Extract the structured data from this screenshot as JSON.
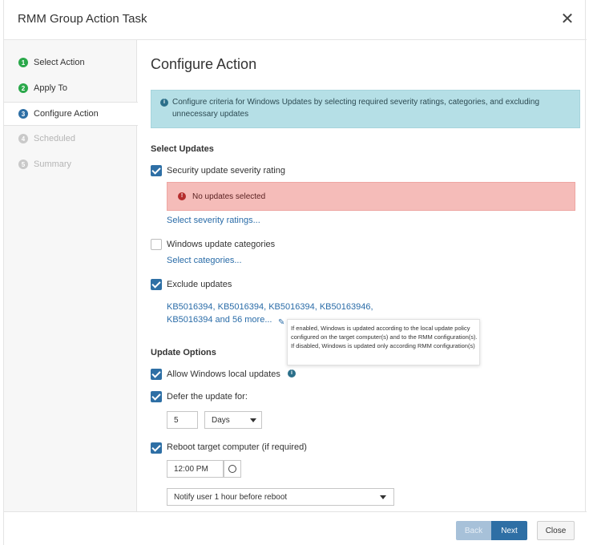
{
  "window": {
    "title": "RMM Group Action Task",
    "close_icon": "close-icon"
  },
  "steps": [
    {
      "num": "1",
      "label": "Select Action",
      "status": "done"
    },
    {
      "num": "2",
      "label": "Apply To",
      "status": "done"
    },
    {
      "num": "3",
      "label": "Configure Action",
      "status": "current"
    },
    {
      "num": "4",
      "label": "Scheduled",
      "status": "pending"
    },
    {
      "num": "5",
      "label": "Summary",
      "status": "pending"
    }
  ],
  "main": {
    "title": "Configure Action",
    "info_text": "Configure criteria for Windows Updates by selecting required severity ratings, categories, and excluding unnecessary updates",
    "select_updates_heading": "Select Updates",
    "severity": {
      "label": "Security update severity rating",
      "checked": true
    },
    "error_text": "No updates selected",
    "severity_link": "Select severity ratings...",
    "categories": {
      "label": "Windows update categories",
      "checked": false
    },
    "categories_link": "Select categories...",
    "exclude": {
      "label": "Exclude updates",
      "checked": true
    },
    "excluded_line1": "KB5016394, KB5016394, KB5016394, KB50163946,",
    "excluded_line2": "KB5016394 and 56 more...",
    "tooltip": "If enabled, Windows is updated according to the local update policy configured on the target computer(s) and to the RMM configuration(s). If disabled, Windows is updated only according RMM configuration(s)",
    "update_options_heading": "Update Options",
    "allow_local": {
      "label": "Allow Windows local updates",
      "checked": true
    },
    "defer": {
      "label": "Defer the update for:",
      "checked": true,
      "value": "5",
      "unit": "Days"
    },
    "reboot": {
      "label": "Reboot target computer (if required)",
      "checked": true,
      "time": "12:00 PM",
      "notify": "Notify user 1 hour before reboot"
    }
  },
  "footer": {
    "back": "Back",
    "next": "Next",
    "close": "Close"
  },
  "colors": {
    "accent": "#2e6fa5",
    "done": "#2aa84a",
    "info_bg": "#b5dfe6",
    "error_bg": "#f5bcb9"
  }
}
